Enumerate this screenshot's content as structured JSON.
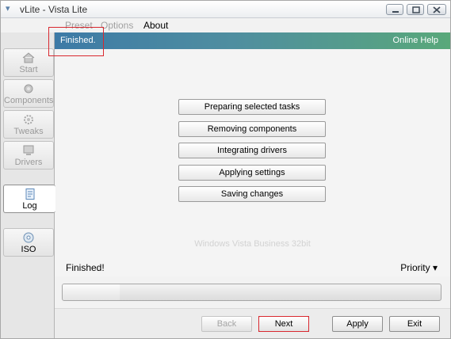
{
  "window": {
    "title": "vLite - Vista Lite"
  },
  "menu": {
    "preset": "Preset",
    "options": "Options",
    "about": "About"
  },
  "sidebar": {
    "items": [
      {
        "label": "Start"
      },
      {
        "label": "Components"
      },
      {
        "label": "Tweaks"
      },
      {
        "label": "Drivers"
      },
      {
        "label": "Log"
      },
      {
        "label": "ISO"
      }
    ]
  },
  "banner": {
    "status": "Finished.",
    "help": "Online Help"
  },
  "tasks": [
    "Preparing selected tasks",
    "Removing components",
    "Integrating drivers",
    "Applying settings",
    "Saving changes"
  ],
  "os_label": "Windows Vista Business 32bit",
  "status": {
    "text": "Finished!",
    "priority": "Priority"
  },
  "progress": {
    "value": 0.15
  },
  "buttons": {
    "back": "Back",
    "next": "Next",
    "apply": "Apply",
    "exit": "Exit"
  }
}
